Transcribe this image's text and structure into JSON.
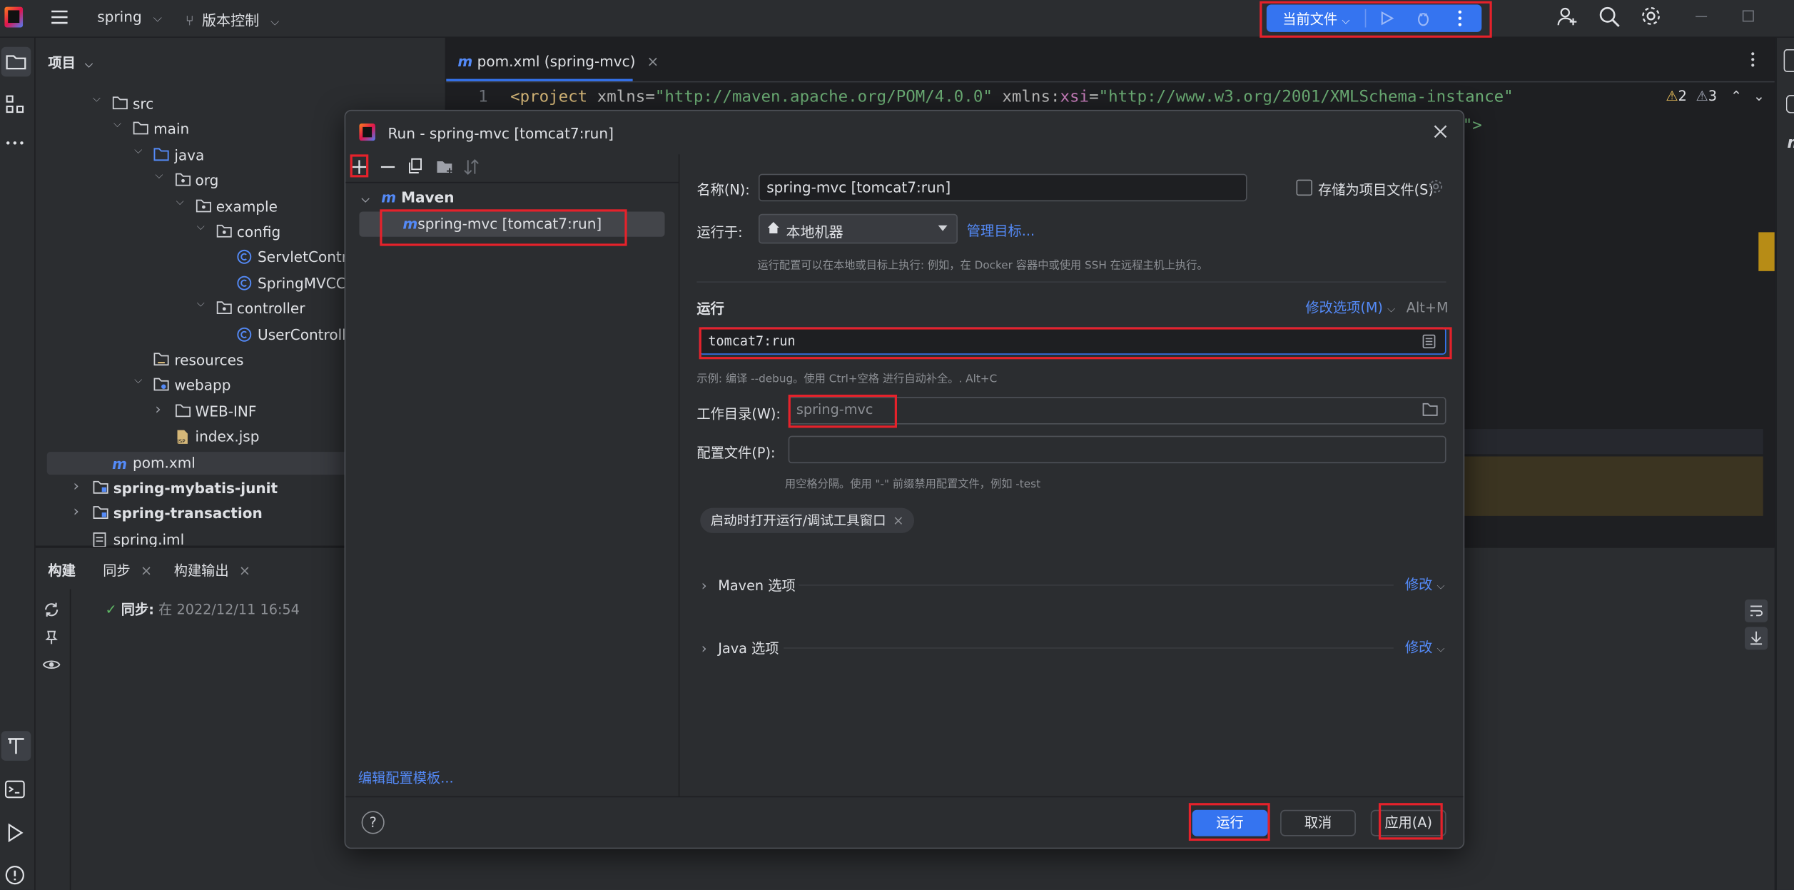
{
  "window": {
    "project_name": "spring",
    "vcs_label": "版本控制",
    "run_config_label": "当前文件"
  },
  "project_panel": {
    "title": "项目"
  },
  "tree": [
    {
      "label": "src",
      "indent": 0,
      "arrow": "down",
      "icon": "folder-icon",
      "bold": false
    },
    {
      "label": "main",
      "indent": 1,
      "arrow": "down",
      "icon": "folder-icon",
      "bold": false
    },
    {
      "label": "java",
      "indent": 2,
      "arrow": "down",
      "icon": "source-folder-icon",
      "bold": false
    },
    {
      "label": "org",
      "indent": 3,
      "arrow": "down",
      "icon": "package-icon",
      "bold": false
    },
    {
      "label": "example",
      "indent": 4,
      "arrow": "down",
      "icon": "package-icon",
      "bold": false
    },
    {
      "label": "config",
      "indent": 5,
      "arrow": "down",
      "icon": "package-icon",
      "bold": false
    },
    {
      "label": "ServletControlle",
      "indent": 6,
      "arrow": "none",
      "icon": "class-icon",
      "bold": false
    },
    {
      "label": "SpringMVCCon",
      "indent": 6,
      "arrow": "none",
      "icon": "class-icon",
      "bold": false
    },
    {
      "label": "controller",
      "indent": 5,
      "arrow": "down",
      "icon": "package-icon",
      "bold": false
    },
    {
      "label": "UserController",
      "indent": 6,
      "arrow": "none",
      "icon": "class-icon",
      "bold": false
    },
    {
      "label": "resources",
      "indent": 2,
      "arrow": "none",
      "icon": "resources-folder-icon",
      "bold": false
    },
    {
      "label": "webapp",
      "indent": 2,
      "arrow": "down",
      "icon": "web-folder-icon",
      "bold": false
    },
    {
      "label": "WEB-INF",
      "indent": 3,
      "arrow": "right",
      "icon": "folder-icon",
      "bold": false
    },
    {
      "label": "index.jsp",
      "indent": 3,
      "arrow": "none",
      "icon": "jsp-file-icon",
      "bold": false
    },
    {
      "label": "pom.xml",
      "indent": 0,
      "arrow": "none",
      "icon": "maven-file-icon",
      "bold": false,
      "selected": true
    },
    {
      "label": "spring-mybatis-junit",
      "indent": -1,
      "arrow": "right",
      "icon": "module-folder-icon",
      "bold": true
    },
    {
      "label": "spring-transaction",
      "indent": -1,
      "arrow": "right",
      "icon": "module-folder-icon",
      "bold": true
    },
    {
      "label": "spring.iml",
      "indent": -1,
      "arrow": "none",
      "icon": "iml-file-icon",
      "bold": false
    }
  ],
  "build_panel": {
    "tab_build": "构建",
    "tab_sync": "同步",
    "tab_build_output": "构建输出",
    "sync_label": "同步:",
    "sync_time": "在 2022/12/11 16:54"
  },
  "editor": {
    "tab_label": "pom.xml (spring-mvc)",
    "line_number": "1",
    "code": {
      "lt": "<",
      "tag": "project",
      "attr1": "xmlns",
      "eq": "=",
      "val1": "\"http://maven.apache.org/POM/4.0.0\"",
      "ns": "xmlns",
      "colon": ":",
      "xsi": "xsi",
      "val2": "\"http://www.w3.org/2001/XMLSchema-instance\"",
      "line2_tail": "d\">"
    },
    "warnings_count": "2",
    "weak_warnings_count": "3"
  },
  "dialog": {
    "title": "Run - spring-mvc [tomcat7:run]",
    "tree_group": "Maven",
    "tree_item": "spring-mvc [tomcat7:run]",
    "edit_templates_link": "编辑配置模板...",
    "name_label": "名称(N):",
    "name_value": "spring-mvc [tomcat7:run]",
    "store_as_file_label": "存储为项目文件(S)",
    "run_on_label": "运行于:",
    "run_on_value": "本地机器",
    "manage_targets_link": "管理目标...",
    "run_on_hint": "运行配置可以在本地或目标上执行: 例如，在 Docker 容器中或使用 SSH 在远程主机上执行。",
    "run_section": "运行",
    "modify_options": "修改选项(M)",
    "modify_shortcut": "Alt+M",
    "command_value": "tomcat7:run",
    "command_hint": "示例: 编译 --debug。使用 Ctrl+空格 进行自动补全。. Alt+C",
    "workdir_label": "工作目录(W):",
    "workdir_value": "spring-mvc",
    "profiles_label": "配置文件(P):",
    "profiles_value": "",
    "profiles_hint": "用空格分隔。使用 \"-\" 前缀禁用配置文件，例如 -test",
    "tag_open_tool_window": "启动时打开运行/调试工具窗口",
    "maven_options": "Maven 选项",
    "java_options": "Java 选项",
    "modify_link": "修改",
    "run_button": "运行",
    "cancel_button": "取消",
    "apply_button": "应用(A)"
  },
  "colors": {
    "accent": "#3574f0",
    "highlight": "#e5222b",
    "bg": "#1e1f22",
    "panel": "#2b2d30"
  }
}
